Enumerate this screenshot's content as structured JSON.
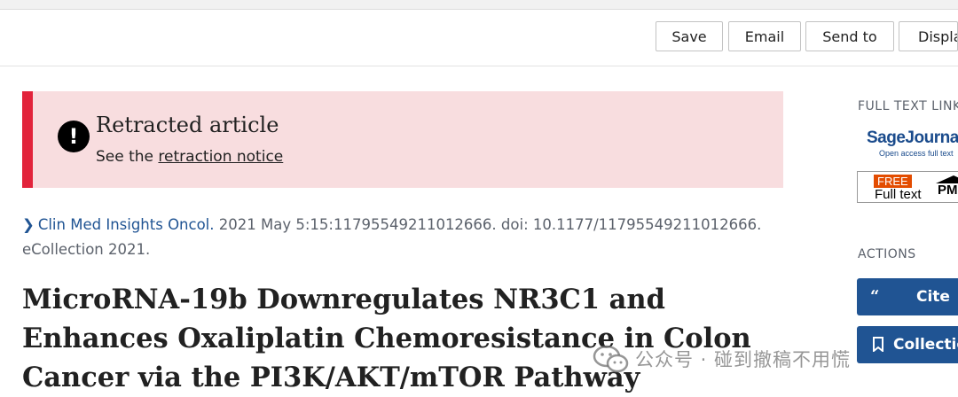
{
  "toolbar": {
    "save_label": "Save",
    "email_label": "Email",
    "send_to_label": "Send to",
    "display_label": "Display options"
  },
  "banner": {
    "title": "Retracted article",
    "note_prefix": "See the",
    "note_link": "retraction notice",
    "accent_color": "#e2233b",
    "background_color": "#f8dddf"
  },
  "citation": {
    "journal": "Clin Med Insights Oncol.",
    "details": " 2021 May 5:15:11795549211012666. doi: 10.1177/11795549211012666. eCollection 2021."
  },
  "article": {
    "title": "MicroRNA-19b Downregulates NR3C1 and Enhances Oxaliplatin Chemoresistance in Colon Cancer via the PI3K/AKT/mTOR Pathway"
  },
  "sidebar": {
    "full_text_heading": "FULL TEXT LINKS",
    "sage_name": "SageJournals",
    "sage_sub": "Open access full text",
    "pmc_free": "FREE",
    "pmc_full_text": "Full text",
    "pmc_logo": "PMC",
    "actions_heading": "ACTIONS",
    "cite_label": "Cite",
    "collections_label": "Collections",
    "accent_color": "#205493"
  },
  "watermark": {
    "text": "公众号 · 碰到撤稿不用慌"
  }
}
